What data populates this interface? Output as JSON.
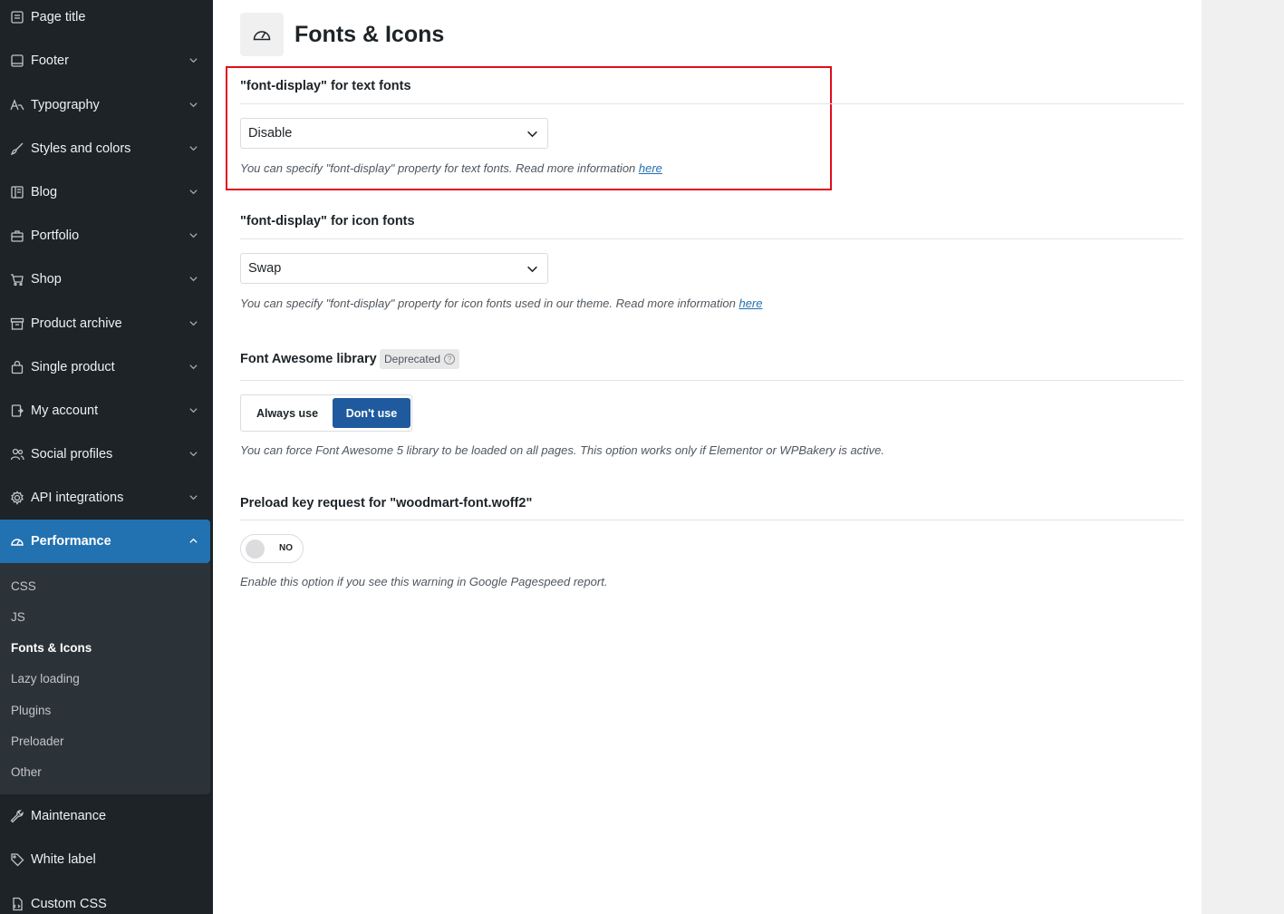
{
  "sidebar": {
    "items": [
      {
        "label": "Page title",
        "icon": "page-icon"
      },
      {
        "label": "Footer",
        "icon": "footer-icon"
      },
      {
        "label": "Typography",
        "icon": "typography-icon"
      },
      {
        "label": "Styles and colors",
        "icon": "brush-icon"
      },
      {
        "label": "Blog",
        "icon": "blog-icon"
      },
      {
        "label": "Portfolio",
        "icon": "briefcase-icon"
      },
      {
        "label": "Shop",
        "icon": "cart-icon"
      },
      {
        "label": "Product archive",
        "icon": "archive-icon"
      },
      {
        "label": "Single product",
        "icon": "bag-icon"
      },
      {
        "label": "My account",
        "icon": "account-icon"
      },
      {
        "label": "Social profiles",
        "icon": "users-icon"
      },
      {
        "label": "API integrations",
        "icon": "gear-icon"
      },
      {
        "label": "Performance",
        "icon": "gauge-icon"
      },
      {
        "label": "Maintenance",
        "icon": "wrench-icon"
      },
      {
        "label": "White label",
        "icon": "tag-icon"
      },
      {
        "label": "Custom CSS",
        "icon": "css-file-icon"
      }
    ],
    "performance_sub": [
      "CSS",
      "JS",
      "Fonts & Icons",
      "Lazy loading",
      "Plugins",
      "Preloader",
      "Other"
    ]
  },
  "page": {
    "title": "Fonts & Icons",
    "icon": "gauge-icon"
  },
  "sections": {
    "text_fonts": {
      "title": "\"font-display\" for text fonts",
      "value": "Disable",
      "desc": "You can specify \"font-display\" property for text fonts. Read more information ",
      "link": "here"
    },
    "icon_fonts": {
      "title": "\"font-display\" for icon fonts",
      "value": "Swap",
      "desc": "You can specify \"font-display\" property for icon fonts used in our theme. Read more information ",
      "link": "here"
    },
    "font_awesome": {
      "title": "Font Awesome library",
      "badge": "Deprecated",
      "badge_help": "?",
      "option_always": "Always use",
      "option_dont": "Don't use",
      "selected": "Don't use",
      "desc": "You can force Font Awesome 5 library to be loaded on all pages. This option works only if Elementor or WPBakery is active."
    },
    "preload": {
      "title": "Preload key request for \"woodmart-font.woff2\"",
      "toggle": "NO",
      "desc": "Enable this option if you see this warning in Google Pagespeed report."
    }
  },
  "colors": {
    "sidebar_bg": "#1d2327",
    "active_blue": "#2271b1",
    "button_selected": "#1f5a9e",
    "highlight_red": "#e00d1b"
  }
}
